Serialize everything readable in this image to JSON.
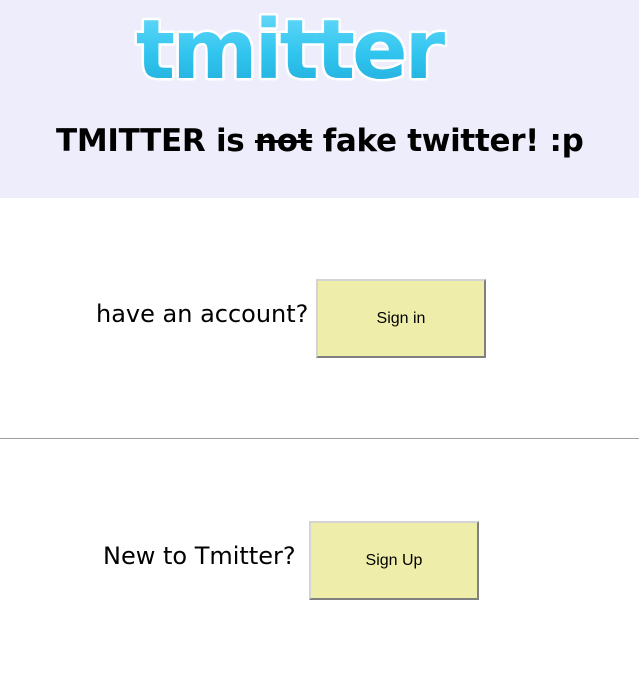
{
  "header": {
    "logo_text": "tmitter",
    "tagline": {
      "before": "TMITTER is ",
      "struck": "not",
      "after": " fake twitter! :p"
    }
  },
  "signin": {
    "prompt": "have an account?",
    "button_label": "Sign in"
  },
  "signup": {
    "prompt": "New to Tmitter?",
    "button_label": "Sign Up"
  },
  "colors": {
    "header_bg": "#eeedfb",
    "logo_fill": "#2fc4ee",
    "button_bg": "#eeeeaa"
  }
}
